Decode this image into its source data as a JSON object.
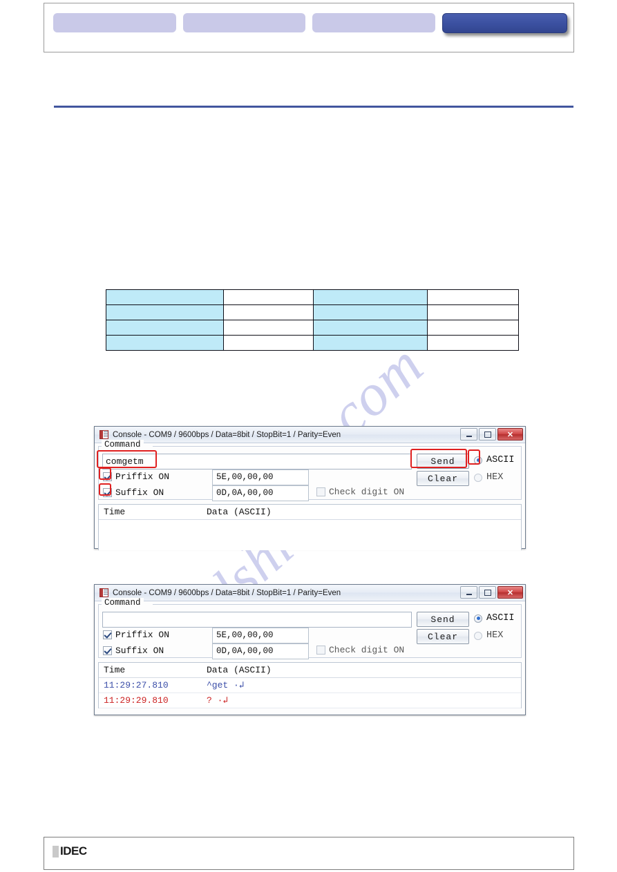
{
  "header": {
    "tabs": [
      {
        "label": "",
        "state": "normal"
      },
      {
        "label": "",
        "state": "normal"
      },
      {
        "label": "",
        "state": "normal"
      },
      {
        "label": "",
        "state": "selected"
      }
    ]
  },
  "table": {
    "columns": [
      "",
      "",
      "",
      ""
    ],
    "rows": [
      [
        "",
        "",
        "",
        ""
      ],
      [
        "",
        "",
        "",
        ""
      ],
      [
        "",
        "",
        "",
        ""
      ],
      [
        "",
        "",
        "",
        ""
      ]
    ]
  },
  "console_windows": [
    {
      "id": "console-window-1",
      "title": "Console - COM9 / 9600bps / Data=8bit / StopBit=1 / Parity=Even",
      "titlebar_buttons": {
        "minimize": "–",
        "maximize": "□",
        "close": "✕"
      },
      "command_group_label": "Command",
      "command_value": "comgetm",
      "command_placeholder": "",
      "send_label": "Send",
      "clear_label": "Clear",
      "format": {
        "ascii_label": "ASCII",
        "hex_label": "HEX",
        "selected": "ASCII"
      },
      "prefix": {
        "label": "Priffix ON",
        "checked": true,
        "value": "5E,00,00,00"
      },
      "suffix": {
        "label": "Suffix ON",
        "checked": true,
        "value": "0D,0A,00,00"
      },
      "check_digit": {
        "label": "Check digit ON",
        "checked": false
      },
      "log": {
        "headers": [
          "Time",
          "Data (ASCII)"
        ],
        "rows": []
      },
      "annotations": [
        "command-input-highlight",
        "send-button-highlight",
        "ascii-radio-highlight",
        "prefix-checkbox-highlight",
        "suffix-checkbox-highlight"
      ]
    },
    {
      "id": "console-window-2",
      "title": "Console - COM9 / 9600bps / Data=8bit / StopBit=1 / Parity=Even",
      "titlebar_buttons": {
        "minimize": "–",
        "maximize": "□",
        "close": "✕"
      },
      "command_group_label": "Command",
      "command_value": "",
      "command_placeholder": "",
      "send_label": "Send",
      "clear_label": "Clear",
      "format": {
        "ascii_label": "ASCII",
        "hex_label": "HEX",
        "selected": "ASCII"
      },
      "prefix": {
        "label": "Priffix ON",
        "checked": true,
        "value": "5E,00,00,00"
      },
      "suffix": {
        "label": "Suffix ON",
        "checked": true,
        "value": "0D,0A,00,00"
      },
      "check_digit": {
        "label": "Check digit ON",
        "checked": false
      },
      "log": {
        "headers": [
          "Time",
          "Data (ASCII)"
        ],
        "rows": [
          {
            "time": "11:29:27.810",
            "data": "^get ·↲",
            "color": "blue"
          },
          {
            "time": "11:29:29.810",
            "data": "? ·↲",
            "color": "red"
          }
        ]
      },
      "annotations": []
    }
  ],
  "footer": {
    "logo_text": "IDEC"
  },
  "watermark": {
    "line1": "hive.com",
    "line2": "manualshi"
  },
  "colors": {
    "accent_blue": "#41569e",
    "tab_inactive": "#c9c9e8",
    "tab_active": "#3b50a0",
    "table_cell_highlight": "#bfeaf8",
    "annotation_red": "#e02020",
    "log_blue": "#3b4ea8",
    "log_red": "#cc2222"
  }
}
